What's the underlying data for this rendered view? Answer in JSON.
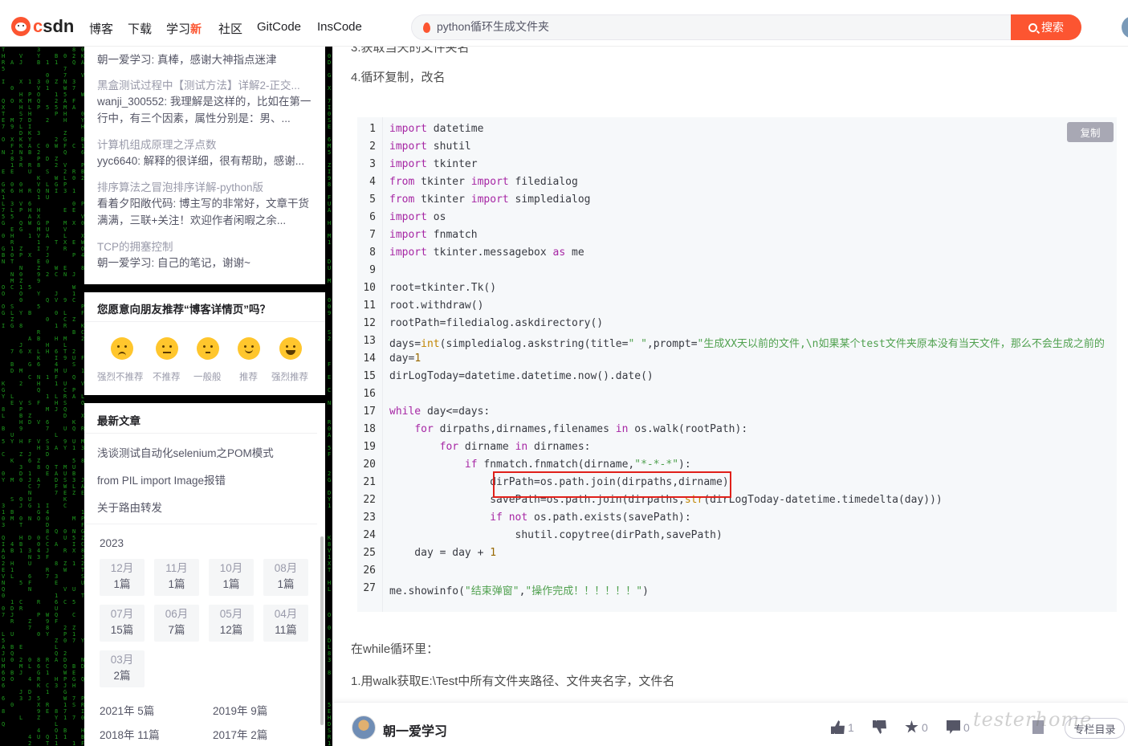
{
  "nav": {
    "brand": "CSDN",
    "items": [
      "博客",
      "下载",
      "学习",
      "社区",
      "GitCode",
      "InsCode"
    ],
    "study_badge": "新",
    "search_value": "python循环生成文件夹",
    "search_button": "搜索"
  },
  "sidebar": {
    "comments": [
      {
        "author_text": "朝一爱学习: 真棒，感谢大神指点迷津"
      },
      {
        "title": "黑盒测试过程中【测试方法】详解2-正交...",
        "text": "wanji_300552: 我理解是这样的，比如在第一行中，有三个因素，属性分别是：男、..."
      },
      {
        "title": "计算机组成原理之浮点数",
        "text": "yyc6640: 解释的很详细，很有帮助，感谢..."
      },
      {
        "title": "排序算法之冒泡排序详解-python版",
        "text": "看着夕阳敞代码: 博主写的非常好，文章干货满满，三联+关注！欢迎作者闲暇之余..."
      },
      {
        "title": "TCP的拥塞控制",
        "text": "朝一爱学习: 自己的笔记，谢谢~"
      }
    ],
    "recommend": {
      "title": "您愿意向朋友推荐“博客详情页”吗？",
      "options": [
        "强烈不推荐",
        "不推荐",
        "一般般",
        "推荐",
        "强烈推荐"
      ]
    },
    "latest": {
      "title": "最新文章",
      "articles": [
        "浅谈测试自动化selenium之POM模式",
        "from PIL import Image报错",
        "关于路由转发"
      ],
      "year": "2023",
      "months": [
        {
          "m": "12月",
          "n": "1篇"
        },
        {
          "m": "11月",
          "n": "1篇"
        },
        {
          "m": "10月",
          "n": "1篇"
        },
        {
          "m": "08月",
          "n": "1篇"
        },
        {
          "m": "07月",
          "n": "15篇"
        },
        {
          "m": "06月",
          "n": "7篇"
        },
        {
          "m": "05月",
          "n": "12篇"
        },
        {
          "m": "04月",
          "n": "11篇"
        },
        {
          "m": "03月",
          "n": "2篇"
        }
      ],
      "years": [
        "2021年  5篇",
        "2019年  9篇",
        "2018年  11篇",
        "2017年  2篇"
      ]
    }
  },
  "article": {
    "line3_partial": "3.获取当天的文件夹名",
    "line4": "4.循环复制，改名",
    "copy_label": "复制",
    "code_lines": [
      "import datetime",
      "import shutil",
      "import tkinter",
      "from tkinter import filedialog",
      "from tkinter import simpledialog",
      "import os",
      "import fnmatch",
      "import tkinter.messagebox as me",
      "",
      "root=tkinter.Tk()",
      "root.withdraw()",
      "rootPath=filedialog.askdirectory()",
      "days=int(simpledialog.askstring(title=\" \",prompt=\"生成XX天以前的文件,\\n如果某个test文件夹原本没有当天文件，那么不会生成之前的",
      "day=1",
      "dirLogToday=datetime.datetime.now().date()",
      "",
      "while day<=days:",
      "    for dirpaths,dirnames,filenames in os.walk(rootPath):",
      "        for dirname in dirnames:",
      "            if fnmatch.fnmatch(dirname,\"*-*-*\"):",
      "                dirPath=os.path.join(dirpaths,dirname)",
      "                savePath=os.path.join(dirpaths,str(dirLogToday-datetime.timedelta(day)))",
      "                if not os.path.exists(savePath):",
      "                    shutil.copytree(dirPath,savePath)",
      "    day = day + 1",
      "",
      "me.showinfo(\"结束弹窗\",\"操作完成！！！！！！\")"
    ],
    "after1": "在while循环里：",
    "after2": "1.用walk获取E:\\Test中所有文件夹路径、文件夹名字，文件名"
  },
  "bottom": {
    "author": "朝一爱学习",
    "likes": "1",
    "favorites": "0",
    "comments": "0",
    "toc": "专栏目录",
    "watermark": "testerhome"
  }
}
